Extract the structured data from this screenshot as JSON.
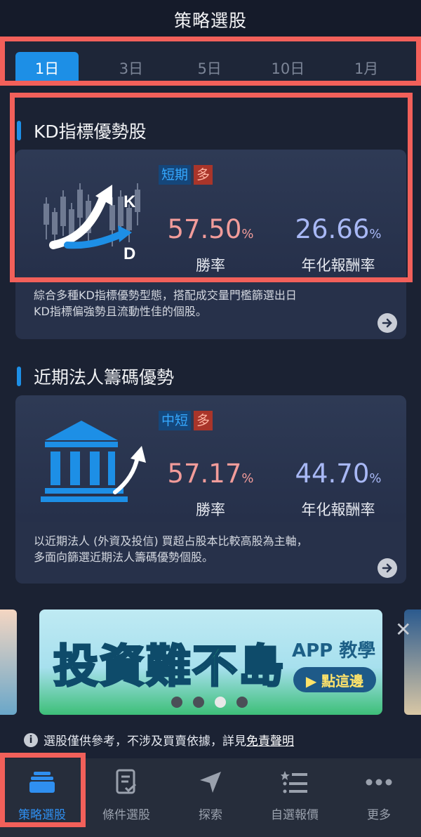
{
  "header": {
    "title": "策略選股"
  },
  "period_tabs": [
    {
      "label": "1日",
      "active": true
    },
    {
      "label": "3日",
      "active": false
    },
    {
      "label": "5日",
      "active": false
    },
    {
      "label": "10日",
      "active": false
    },
    {
      "label": "1月",
      "active": false
    }
  ],
  "strategies": [
    {
      "title": "KD指標優勢股",
      "term": "短期",
      "direction": "多",
      "win_rate": "57.50",
      "win_rate_unit": "%",
      "win_rate_label": "勝率",
      "annual_return": "26.66",
      "annual_return_unit": "%",
      "annual_return_label": "年化報酬率",
      "desc_line1": "綜合多種KD指標優勢型態，搭配成交量門檻篩選出日",
      "desc_line2": "KD指標偏強勢且流動性佳的個股。",
      "icon": "kd-chart-icon",
      "icon_k": "K",
      "icon_d": "D"
    },
    {
      "title": "近期法人籌碼優勢",
      "term": "中短",
      "direction": "多",
      "win_rate": "57.17",
      "win_rate_unit": "%",
      "win_rate_label": "勝率",
      "annual_return": "44.70",
      "annual_return_unit": "%",
      "annual_return_label": "年化報酬率",
      "desc_line1": "以近期法人 (外資及投信) 買超占股本比較高股為主軸，",
      "desc_line2": "多面向篩選近期法人籌碼優勢個股。",
      "icon": "institution-building-icon"
    }
  ],
  "ad": {
    "title": "投資難不島",
    "app_label": "APP 教學",
    "cta": "▶ 點這邊",
    "slides": 4,
    "active_slide": 3
  },
  "disclaimer": {
    "text": "選股僅供參考，不涉及買賣依據，詳見",
    "link": "免責聲明"
  },
  "bottom_nav": [
    {
      "label": "策略選股",
      "icon": "stack-icon",
      "active": true
    },
    {
      "label": "條件選股",
      "icon": "checklist-icon",
      "active": false
    },
    {
      "label": "探索",
      "icon": "navigation-arrow-icon",
      "active": false
    },
    {
      "label": "自選報價",
      "icon": "star-list-icon",
      "active": false
    },
    {
      "label": "更多",
      "icon": "more-dots-icon",
      "active": false
    }
  ],
  "colors": {
    "accent": "#1d8fe6",
    "highlight": "#f2605a",
    "win_rate": "#f29c9a",
    "annual_return": "#a8b8f5"
  }
}
